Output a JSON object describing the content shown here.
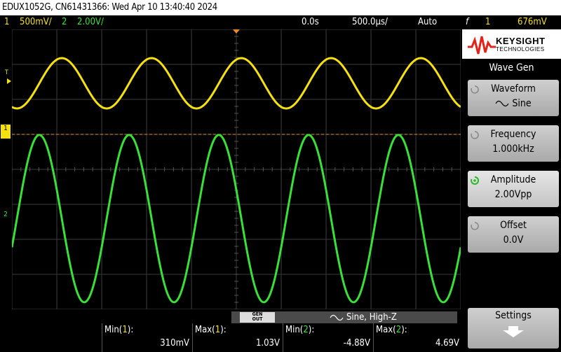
{
  "title": "EDUX1052G, CN61431366: Wed Apr 10 13:40:40 2024",
  "status": {
    "ch1_num": "1",
    "ch1_scale": "500mV/",
    "ch2_num": "2",
    "ch2_scale": "2.00V/",
    "delay": "0.0s",
    "timebase": "500.0µs/",
    "trigger_mode": "Auto",
    "trigger_icon": "f",
    "trigger_ch": "1",
    "trigger_level": "676mV"
  },
  "logo": {
    "line1": "KEYSIGHT",
    "line2": "TECHNOLOGIES"
  },
  "menu": {
    "title": "Wave Gen",
    "waveform_label": "Waveform",
    "waveform_value": "Sine",
    "frequency_label": "Frequency",
    "frequency_value": "1.000kHz",
    "amplitude_label": "Amplitude",
    "amplitude_value": "2.00Vpp",
    "offset_label": "Offset",
    "offset_value": "0.0V",
    "settings_label": "Settings"
  },
  "gen_bar": {
    "button_top": "GEN",
    "button_bottom": "OUT",
    "text": "Sine, High-Z"
  },
  "measurements": [
    {
      "label": "Min(1):",
      "value": "310mV"
    },
    {
      "label": "Max(1):",
      "value": "1.03V"
    },
    {
      "label": "Min(2):",
      "value": "-4.88V"
    },
    {
      "label": "Max(2):",
      "value": "4.69V"
    }
  ],
  "markers": {
    "trigger_marker": "T",
    "ch1_marker": "1",
    "ch2_marker": "2"
  },
  "colors": {
    "ch1": "#f5e10f",
    "ch2": "#38e03a",
    "trigger_line": "#e98b24",
    "grid": "#3c3c3c"
  },
  "waveforms": {
    "ch1": {
      "cycles": 5,
      "min_v": 0.31,
      "max_v": 1.03
    },
    "ch2": {
      "cycles": 5,
      "min_v": -4.88,
      "max_v": 4.69
    }
  }
}
